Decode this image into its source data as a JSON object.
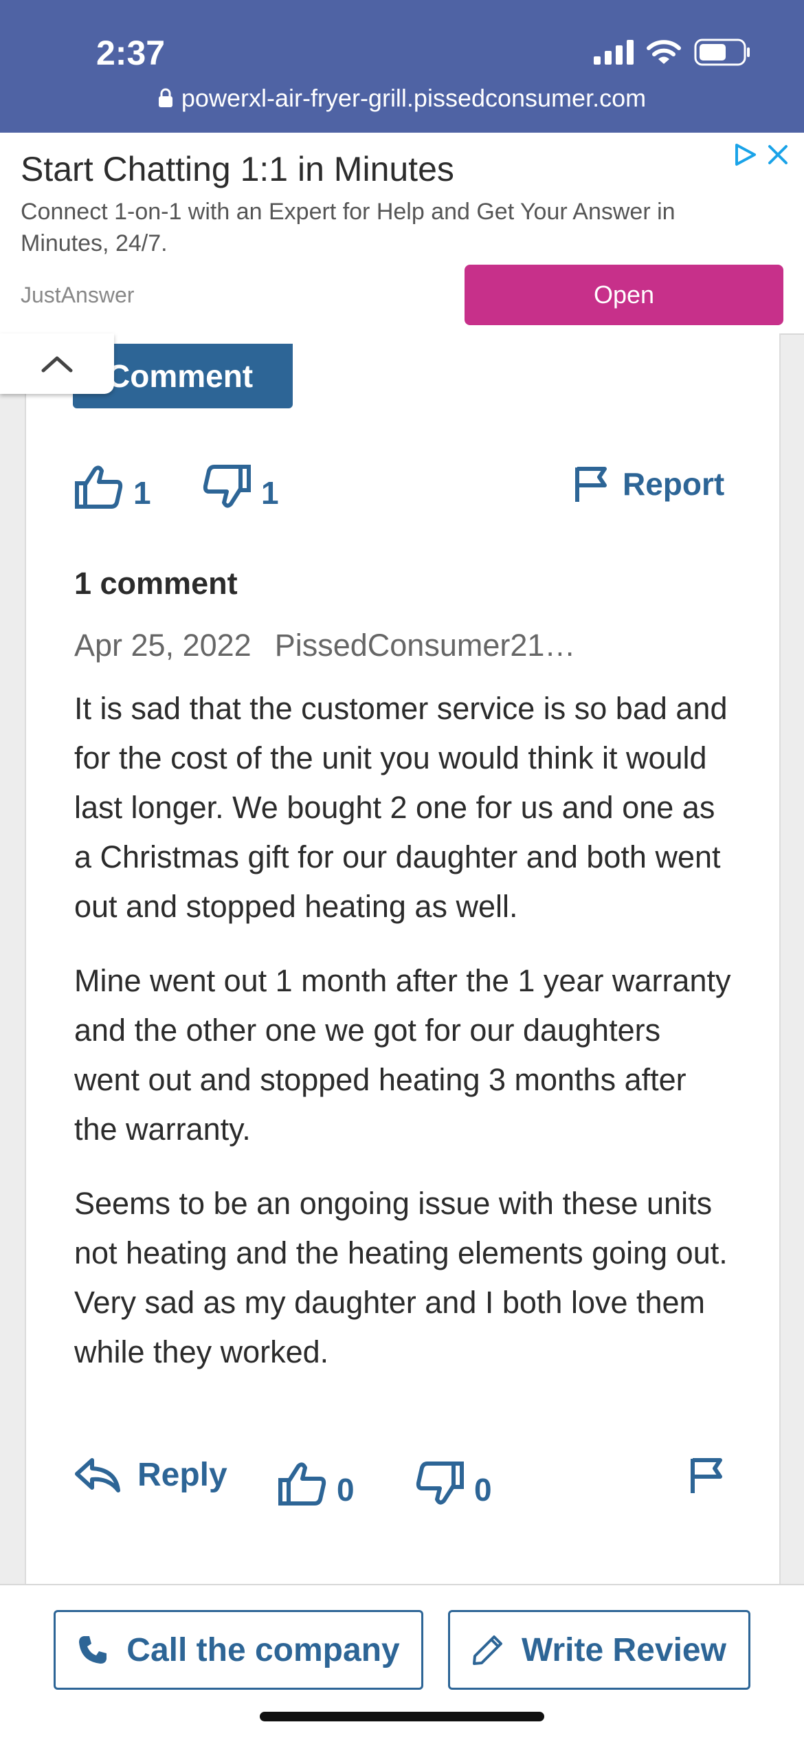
{
  "status_bar": {
    "time": "2:37"
  },
  "browser": {
    "url": "powerxl-air-fryer-grill.pissedconsumer.com"
  },
  "ad": {
    "title": "Start Chatting 1:1 in Minutes",
    "description": "Connect 1-on-1 with an Expert for Help and Get Your Answer in Minutes, 24/7.",
    "source": "JustAnswer",
    "open_label": "Open"
  },
  "review": {
    "comment_button_label": "Comment",
    "thumbs_up_count": "1",
    "thumbs_down_count": "1",
    "report_label": "Report"
  },
  "comments": {
    "count_label": "1 comment",
    "items": [
      {
        "date": "Apr 25, 2022",
        "author": "PissedConsumer21…",
        "paragraphs": [
          "It is sad that the customer service is so bad and for the cost of the unit you would think it would last longer. We bought 2 one for us and one as a Christmas gift for our daughter and both went out and stopped heating as well.",
          "Mine went out 1 month after the 1 year warranty and the other one we got for our daughters went out and stopped heating 3 months after the warranty.",
          "Seems to be an ongoing issue with these units not heating and the heating elements going out. Very sad as my daughter and I both love them while they worked."
        ],
        "reply_label": "Reply",
        "thumbs_up_count": "0",
        "thumbs_down_count": "0"
      }
    ]
  },
  "bottom_bar": {
    "call_label": "Call the company",
    "write_label": "Write Review"
  },
  "colors": {
    "status_bar_bg": "#4f63a4",
    "accent_blue": "#2d6596",
    "ad_button": "#c7308a"
  }
}
